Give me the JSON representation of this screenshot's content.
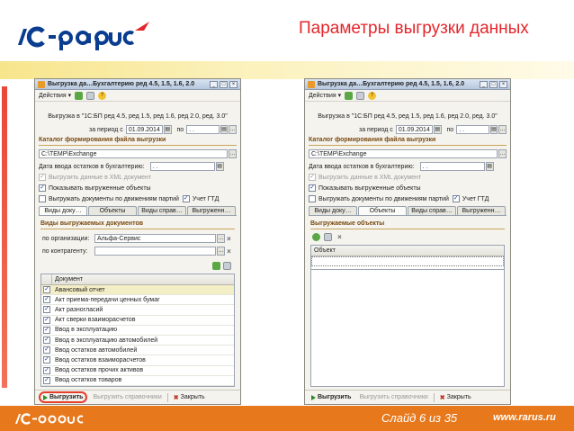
{
  "slide": {
    "title": "Параметры выгрузки данных",
    "number": "Слайд 6 из 35",
    "site": "www.rarus.ru",
    "brand_color": "#e4262b",
    "footer_color": "#e8781c"
  },
  "window_common": {
    "title": "Выгрузка да…Бухгалтерию ред 4.5, 1.5, 1.6, 2.0",
    "actions_label": "Действия ▾",
    "header_text": "Выгрузка  в \"1С:БП ред 4.5, ред 1.5, ред 1.6, ред 2.0, ред. 3.0\"",
    "period_label": "за период с",
    "period_from": "01.09.2014",
    "period_to_label": "по",
    "period_to": " .  .",
    "catalog_section": "Каталог формирования файла выгрузки",
    "catalog_path": "C:\\TEMP\\Exchange",
    "balance_date_label": "Дата ввода остатков в бухгалтерию:",
    "balance_date": " .  .",
    "xml_checkbox": "Выгрузить данные в XML документ",
    "show_checkbox": "Показывать выгруженные объекты",
    "partial_checkbox": "Выгружать документы по движениям партий",
    "gtd_checkbox": "Учет ГТД",
    "tabs": [
      "Виды доку…",
      "Объекты",
      "Виды справ…",
      "Выгруженн…"
    ],
    "export_button": "Выгрузить",
    "export_refs_button": "Выгрузить справочники",
    "close_button": "Закрыть"
  },
  "left_window": {
    "docs_section": "Виды выгружаемых документов",
    "org_label": "по организации:",
    "org_value": "Альфа-Сервис",
    "contractor_label": "по контрагенту:",
    "contractor_value": "",
    "grid_header": "Документ",
    "documents": [
      "Авансовый отчет",
      "Акт приема-передачи ценных бумаг",
      "Акт разногласий",
      "Акт сверки взаиморасчетов",
      "Ввод в эксплуатацию",
      "Ввод в эксплуатацию автомобилей",
      "Ввод остатков автомобилей",
      "Ввод остатков взаиморасчетов",
      "Ввод остатков прочих активов",
      "Ввод остатков товаров"
    ]
  },
  "right_window": {
    "objects_section": "Выгружаемые объекты",
    "grid_header": "Объект"
  }
}
